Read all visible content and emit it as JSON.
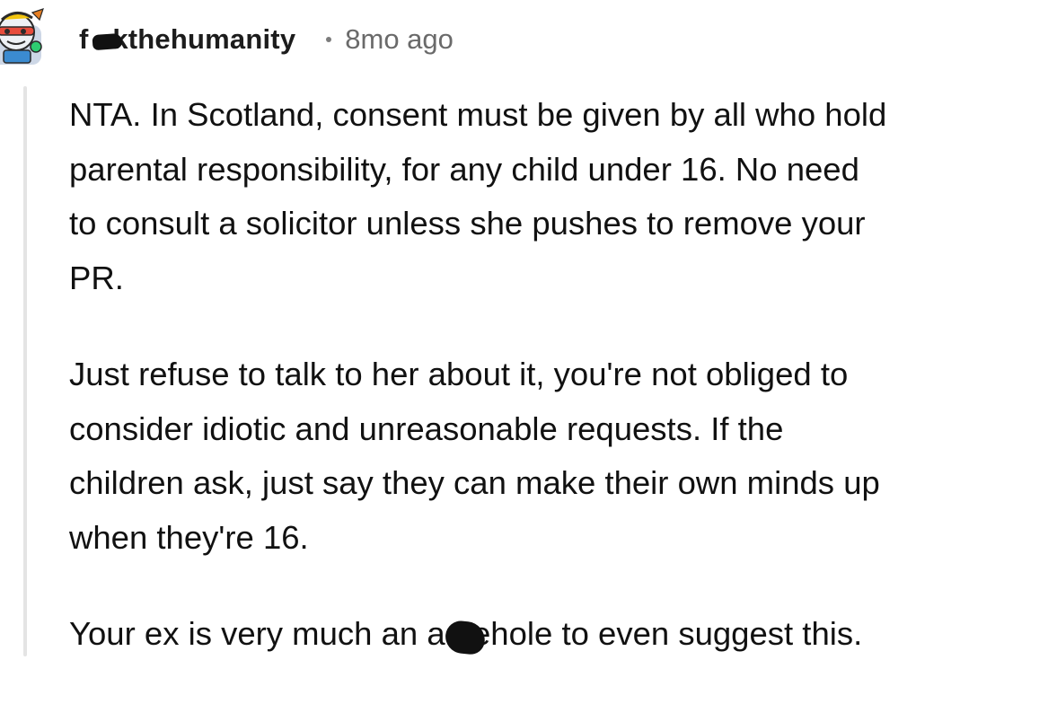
{
  "comment": {
    "author": "f     kthehumanity",
    "separator": "•",
    "timestamp": "8mo ago",
    "paragraphs": [
      {
        "lines": [
          "NTA. In Scotland, consent must be given by all who hold",
          "parental responsibility, for any child under 16. No need",
          "to consult a solicitor unless she pushes to remove your",
          "PR."
        ]
      },
      {
        "lines": [
          "Just refuse to talk to her about it, you're not obliged to",
          "consider idiotic and unreasonable requests. If the",
          "children ask, just say they can make their own minds up",
          "when they're 16."
        ]
      },
      {
        "line_before": "Your ex is very much an ",
        "redacted_word": "a     ehole",
        "line_after": " to even suggest this."
      }
    ]
  },
  "colors": {
    "text": "#111111",
    "meta": "#6a6a6a",
    "thread_line": "#e4e4e4"
  },
  "icons": {
    "avatar": "snoovatar-avatar"
  }
}
